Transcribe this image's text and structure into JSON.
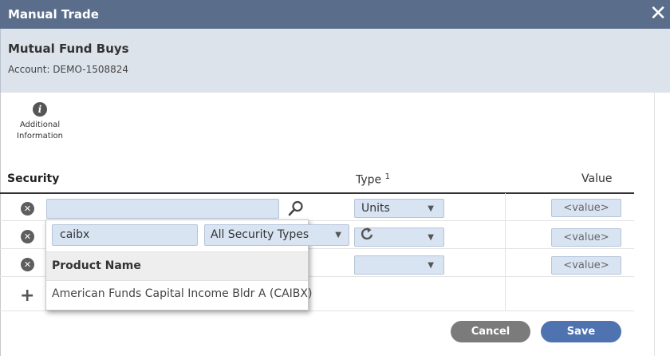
{
  "dialog": {
    "title": "Manual Trade",
    "close_glyph": "✕"
  },
  "header": {
    "title": "Mutual Fund Buys",
    "account": "Account: DEMO-1508824"
  },
  "info": {
    "icon": "info-icon",
    "label_line1": "Additional",
    "label_line2": "Information"
  },
  "table": {
    "col_security": "Security",
    "col_type": "Type",
    "col_type_sup": "1",
    "col_value": "Value",
    "rows": [
      {
        "type": "Units",
        "value_placeholder": "<value>"
      },
      {
        "type": "",
        "value_placeholder": "<value>"
      },
      {
        "type": "",
        "value_placeholder": "<value>"
      }
    ]
  },
  "search_popup": {
    "query": "caibx",
    "security_type": "All Security Types",
    "column_header": "Product Name",
    "results": [
      "American Funds Capital Income Bldr A (CAIBX)"
    ]
  },
  "footer": {
    "cancel_label": "Cancel",
    "save_label": "Save"
  },
  "colors": {
    "titlebar": "#5a6e8c",
    "header_bg": "#dde3ea",
    "input_bg": "#d9e4f3",
    "save_button": "#4f73b0",
    "cancel_button": "#7b7b7b"
  }
}
